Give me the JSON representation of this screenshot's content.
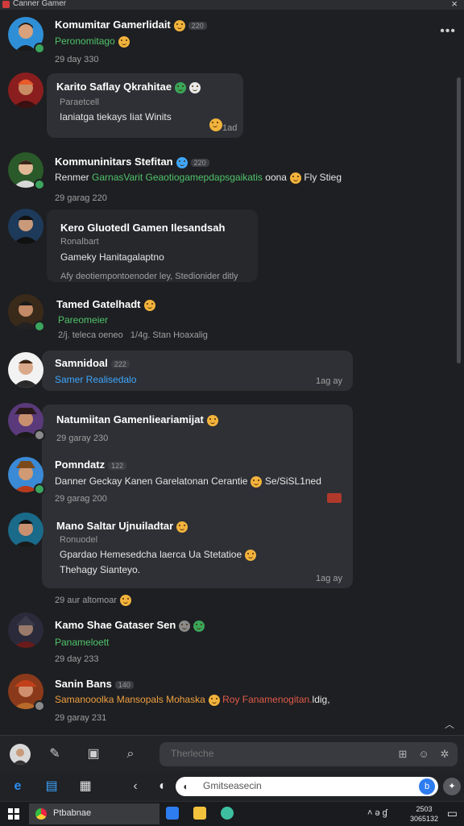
{
  "window": {
    "title": "Canner Gamer"
  },
  "colors": {
    "bg": "#1e1f22",
    "bubble": "#2e3035",
    "green": "#4fc36b",
    "blue": "#3ea6ff",
    "online": "#3ba55d"
  },
  "feed": {
    "more_label": "•••",
    "m1": {
      "name": "Komumitar Gamerlidait",
      "badge": "220",
      "sub": "Peronomitago",
      "time": "29 day 330"
    },
    "m2": {
      "name": "Karito Saflay Qkrahitae",
      "sub": "Paraetcell",
      "msg": "Ianiatga tiekays Iiat Winits",
      "time": "1ad"
    },
    "m3": {
      "name": "Kommuninitars Stefitan",
      "badge": "220",
      "sub_prefix": "Renmer",
      "sub_green": "GarnasVarit Geaotiogamepdapsgaikatis",
      "sub_suffix": "oona",
      "sub_tail": "Fly Stieg",
      "time": "29 garag 220"
    },
    "m4": {
      "name": "Kero Gluotedl Gamen Ilesandsah",
      "sub": "Ronalbart",
      "msg": "Gameky Hanitagalaptno",
      "time": "Afy deotiempontoenoder ley, Stedionider ditly"
    },
    "m5": {
      "name": "Tamed Gatelhadt",
      "sub": "Pareomeier",
      "time": "2/j. teleca oeneo",
      "time2": "1/4g. Stan Hoaxalig"
    },
    "m6": {
      "name": "Samnidoal",
      "badge": "222",
      "sub": "Samer Realisedalo",
      "time": "1ag ay"
    },
    "m7": {
      "name": "Natumiitan Gamenlieariamijat",
      "time": "29 garay 230"
    },
    "m8": {
      "name": "Pomndatz",
      "badge": "122",
      "msg": "Danner Geckay Kanen Garelatonan Cerantie",
      "msg_tail": "Se/SiSL1ned",
      "time": "29 garag 200"
    },
    "m9": {
      "name": "Mano Saltar Ujnuiladtar",
      "sub": "Ronuodel",
      "msg": "Gpardao Hemesedcha laerca Ua Stetatioe",
      "msg2": "Thehagy Sianteyo.",
      "time": "1ag ay"
    },
    "sep": {
      "text": "29 aur altomoar"
    },
    "m10": {
      "name": "Kamo Shae Gataser Sen",
      "sub": "Panameloett",
      "time": "29 day 233"
    },
    "m11": {
      "name": "Sanin Bans",
      "badge": "140",
      "sub_orange": "Samanooolka Mansopals Mohaska",
      "sub_red": "Roy Fanamenogitan.",
      "sub_tail": "ldig,",
      "time": "29 garay 231"
    }
  },
  "composer": {
    "placeholder": "Therleche"
  },
  "taskbar": {
    "search_text": "Gmitseasecin",
    "app_label": "Ptbabnae",
    "tray_text": "˄ ə ɠ",
    "clock_line1": "2503",
    "clock_line2": "3065132"
  }
}
